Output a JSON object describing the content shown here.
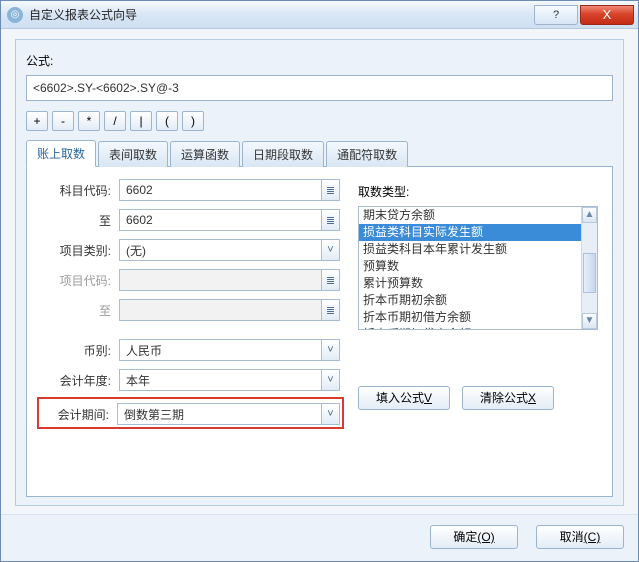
{
  "window": {
    "title": "自定义报表公式向导",
    "help_label": "?",
    "close_label": "X"
  },
  "formula": {
    "label": "公式:",
    "value": "<6602>.SY-<6602>.SY@-3"
  },
  "operators": [
    "+",
    "-",
    "*",
    "/",
    "|",
    "(",
    ")"
  ],
  "tabs": [
    {
      "id": "t1",
      "label": "账上取数",
      "active": true
    },
    {
      "id": "t2",
      "label": "表间取数"
    },
    {
      "id": "t3",
      "label": "运算函数"
    },
    {
      "id": "t4",
      "label": "日期段取数"
    },
    {
      "id": "t5",
      "label": "通配符取数"
    }
  ],
  "form": {
    "subject_code": {
      "label": "科目代码:",
      "value": "6602",
      "mode": "menu"
    },
    "subject_to": {
      "label": "至",
      "value": "6602",
      "mode": "menu"
    },
    "item_type": {
      "label": "项目类别:",
      "value": "(无)",
      "mode": "dropdown"
    },
    "item_code": {
      "label": "项目代码:",
      "value": "",
      "mode": "menu",
      "disabled": true
    },
    "item_to": {
      "label": "至",
      "value": "",
      "mode": "menu",
      "disabled": true
    },
    "currency": {
      "label": "币别:",
      "value": "人民币",
      "mode": "dropdown"
    },
    "fiscal_year": {
      "label": "会计年度:",
      "value": "本年",
      "mode": "dropdown"
    },
    "fiscal_period": {
      "label": "会计期间:",
      "value": "倒数第三期",
      "mode": "dropdown",
      "highlight": true
    }
  },
  "pick": {
    "label": "取数类型:",
    "items": [
      "期末贷方余额",
      "损益类科目实际发生额",
      "损益类科目本年累计发生额",
      "预算数",
      "累计预算数",
      "折本币期初余额",
      "折本币期初借方余额",
      "折本币期初贷方余额"
    ],
    "selected_index": 1
  },
  "buttons": {
    "insert": "填入公式",
    "insert_suffix": "V",
    "clear": "清除公式",
    "clear_suffix": "X",
    "ok": "确定",
    "ok_suffix": "(O)",
    "cancel": "取消",
    "cancel_suffix": "(C)"
  },
  "icons": {
    "menu": "≣",
    "dropdown": "˅",
    "up": "▲",
    "down": "▼"
  }
}
